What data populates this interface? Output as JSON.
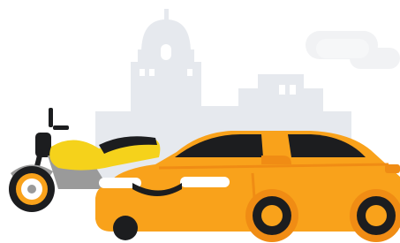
{
  "illustration": {
    "subject": "city-skyline-with-motorcycle-and-car",
    "icons": [
      "cloud-icon",
      "building-icon",
      "motorcycle-icon",
      "car-icon"
    ],
    "colors": {
      "background": "#ffffff",
      "building": "#e6e9ee",
      "building_window": "#ffffff",
      "cloud": "#f1f2f4",
      "car_body": "#f9a21b",
      "car_body_dark": "#f08c14",
      "car_glass": "#1c1d1f",
      "car_light": "#ffffff",
      "tire": "#1c1d1f",
      "rim": "#f9a21b",
      "moto_body": "#f5d21b",
      "moto_frame": "#9a9a9a",
      "moto_dark": "#1c1d1f"
    }
  }
}
